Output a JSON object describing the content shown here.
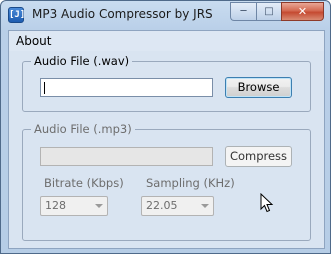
{
  "window": {
    "title": "MP3 Audio Compressor by JRS",
    "app_icon_glyph": "[J]",
    "icon": "app-icon",
    "caption": {
      "minimize": "minimize-icon",
      "maximize": "maximize-icon",
      "close": "close-icon"
    }
  },
  "menu": {
    "items": [
      "About"
    ]
  },
  "wav_group": {
    "title": "Audio File (.wav)",
    "input_value": "",
    "browse_label": "Browse"
  },
  "mp3_group": {
    "title": "Audio File (.mp3)",
    "input_value": "",
    "compress_label": "Compress",
    "bitrate_label": "Bitrate (Kbps)",
    "bitrate_value": "128",
    "sampling_label": "Sampling (KHz)",
    "sampling_value": "22.05"
  },
  "colors": {
    "window_frame": "#b6cde6",
    "client_bg": "#d9e4f1",
    "close_button": "#c54a31",
    "disabled_text": "#6d6d6d"
  }
}
